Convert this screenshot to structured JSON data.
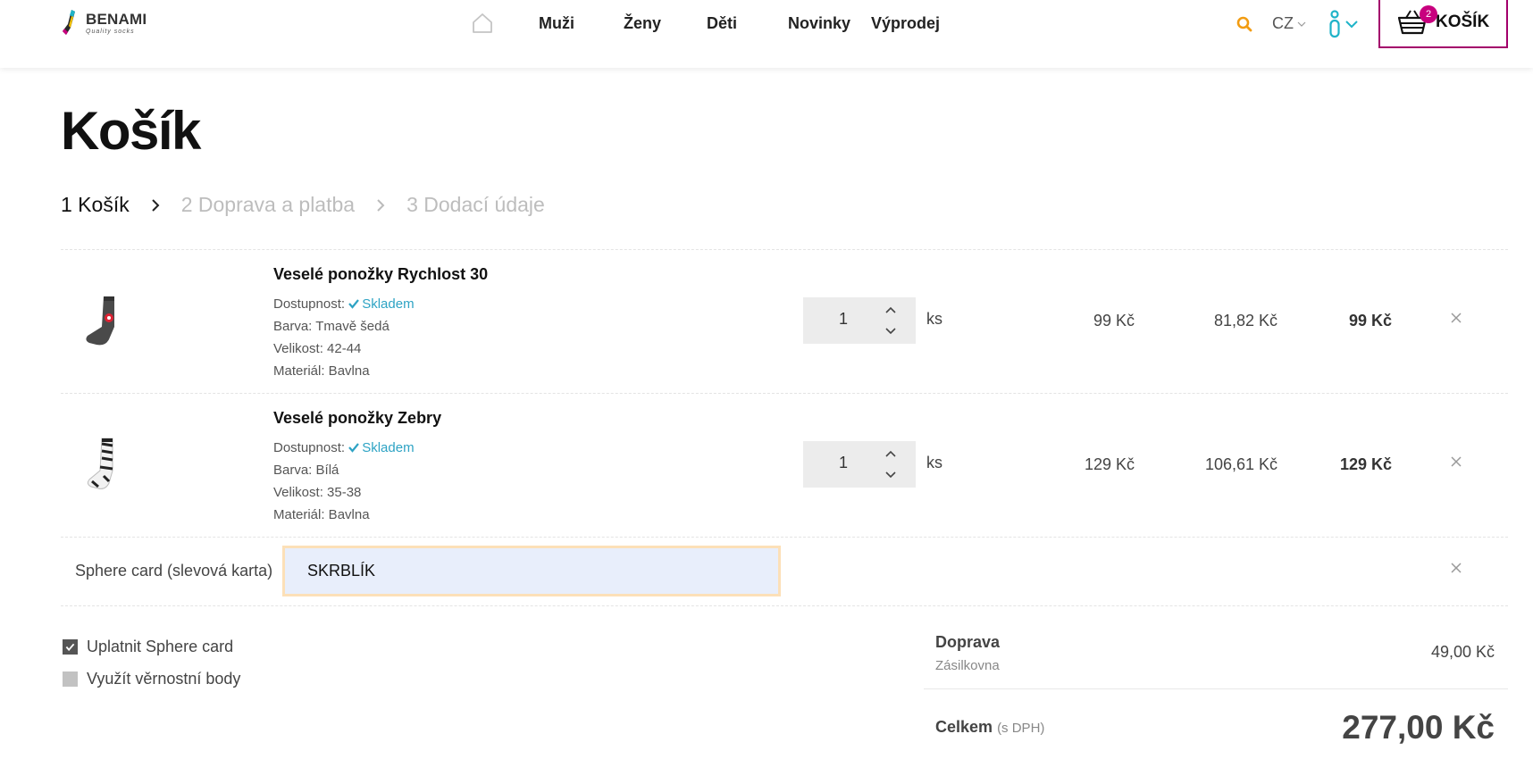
{
  "header": {
    "logo_name": "BENAMI",
    "logo_tagline": "Quality socks",
    "nav": [
      "Muži",
      "Ženy",
      "Děti",
      "Novinky",
      "Výprodej"
    ],
    "lang": "CZ",
    "cart_label": "KOŠÍK",
    "cart_count": "2"
  },
  "page": {
    "title": "Košík"
  },
  "steps": [
    {
      "label": "1 Košík",
      "state": "active"
    },
    {
      "label": "2 Doprava a platba",
      "state": "inactive"
    },
    {
      "label": "3 Dodací údaje",
      "state": "inactive"
    }
  ],
  "items": [
    {
      "name": "Veselé ponožky Rychlost 30",
      "availability_label": "Dostupnost:",
      "availability_value": "Skladem",
      "color": "Barva: Tmavě šedá",
      "size": "Velikost: 42-44",
      "material": "Materiál: Bavlna",
      "qty": "1",
      "unit": "ks",
      "price": "99 Kč",
      "price_net": "81,82 Kč",
      "total": "99 Kč"
    },
    {
      "name": "Veselé ponožky Zebry",
      "availability_label": "Dostupnost:",
      "availability_value": "Skladem",
      "color": "Barva: Bílá",
      "size": "Velikost: 35-38",
      "material": "Materiál: Bavlna",
      "qty": "1",
      "unit": "ks",
      "price": "129 Kč",
      "price_net": "106,61 Kč",
      "total": "129 Kč"
    }
  ],
  "sphere_card": {
    "label": "Sphere card (slevová karta)",
    "value": "SKRBLÍK"
  },
  "options": {
    "apply_sphere": "Uplatnit Sphere card",
    "use_points": "Využít věrnostní body"
  },
  "summary": {
    "shipping_label": "Doprava",
    "shipping_method": "Zásilkovna",
    "shipping_price": "49,00 Kč",
    "total_label": "Celkem",
    "total_note": "(s DPH)",
    "total_value": "277,00 Kč"
  },
  "colors": {
    "accent": "#c8007e",
    "cart_border": "#a3006b",
    "availability": "#2ea3c4",
    "search": "#f29c11",
    "user": "#1eb3c8"
  }
}
